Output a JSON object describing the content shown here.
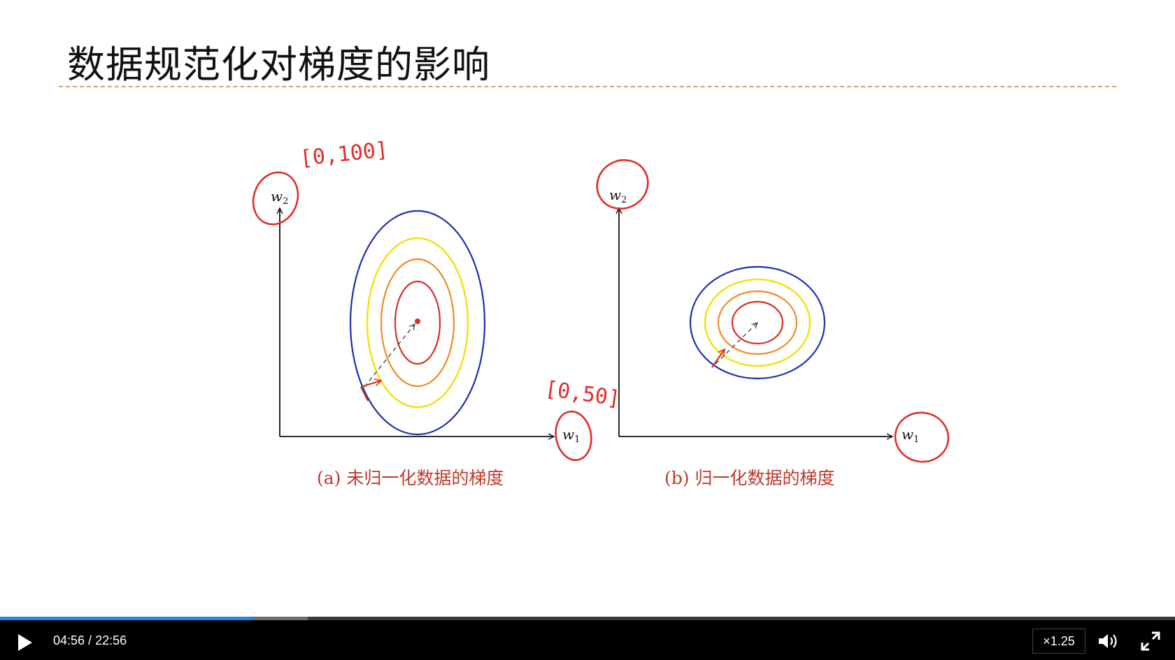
{
  "slide": {
    "title": "数据规范化对梯度的影响",
    "diagram_a": {
      "x_axis_label": "w",
      "x_axis_sub": "1",
      "y_axis_label": "w",
      "y_axis_sub": "2",
      "caption": "(a) 未归一化数据的梯度",
      "annotation_top": "[0,100]",
      "annotation_right": "[0,50]"
    },
    "diagram_b": {
      "x_axis_label": "w",
      "x_axis_sub": "1",
      "y_axis_label": "w",
      "y_axis_sub": "2",
      "caption": "(b) 归一化数据的梯度"
    },
    "contour_colors": [
      "#1f2fb0",
      "#f2e21c",
      "#ef8b22",
      "#d7301f"
    ],
    "ink_color": "#e32b2b"
  },
  "player": {
    "current_time": "04:56",
    "total_time": "22:56",
    "progress_fraction": 0.2151,
    "buffered_fraction": 0.262,
    "speed_label": "×1.25",
    "play_icon": "play-icon",
    "volume_icon": "volume-icon",
    "fullscreen_icon": "fullscreen-icon"
  }
}
